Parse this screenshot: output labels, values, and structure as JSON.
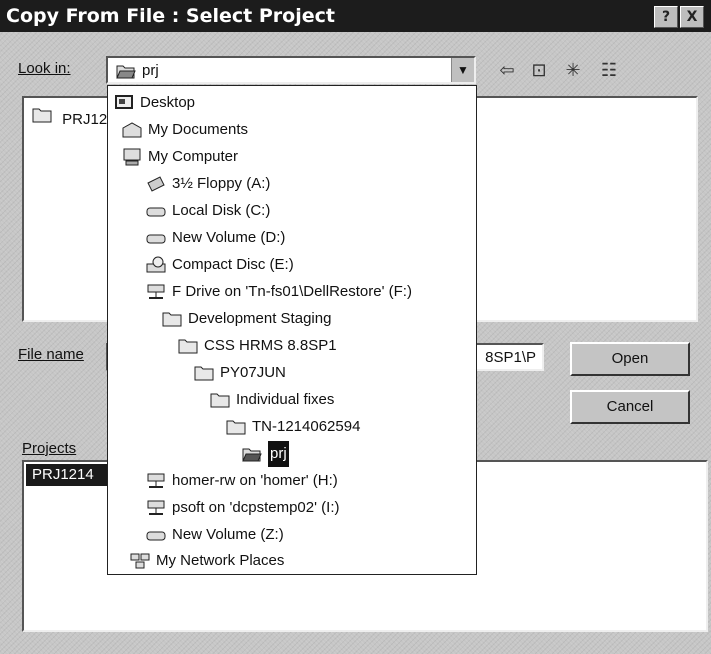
{
  "window": {
    "title": "Copy From File : Select Project",
    "help_glyph": "?",
    "close_glyph": "X"
  },
  "lookin": {
    "label": "Look in:",
    "value": "prj"
  },
  "file_list": {
    "items": [
      "PRJ12"
    ]
  },
  "file_name": {
    "label": "File name",
    "value": "8SP1\\P"
  },
  "projects": {
    "label": "Projects",
    "selected": "PRJ1214"
  },
  "buttons": {
    "open": "Open",
    "cancel": "Cancel"
  },
  "dropdown": {
    "items": [
      {
        "label": "Desktop",
        "icon": "desktop-icon"
      },
      {
        "label": "My Documents",
        "icon": "folder-docs-icon"
      },
      {
        "label": "My Computer",
        "icon": "computer-icon"
      },
      {
        "label": "3½ Floppy (A:)",
        "icon": "floppy-icon"
      },
      {
        "label": "Local Disk (C:)",
        "icon": "disk-icon"
      },
      {
        "label": "New Volume (D:)",
        "icon": "disk-icon"
      },
      {
        "label": "Compact Disc (E:)",
        "icon": "cd-icon"
      },
      {
        "label": "F Drive on 'Tn-fs01\\DellRestore' (F:)",
        "icon": "network-drive-icon"
      },
      {
        "label": "Development Staging",
        "icon": "folder-icon"
      },
      {
        "label": "CSS HRMS 8.8SP1",
        "icon": "folder-icon"
      },
      {
        "label": "PY07JUN",
        "icon": "folder-icon"
      },
      {
        "label": "Individual fixes",
        "icon": "folder-icon"
      },
      {
        "label": "TN-1214062594",
        "icon": "folder-icon"
      },
      {
        "label": "prj",
        "icon": "open-folder-icon"
      },
      {
        "label": "homer-rw on 'homer' (H:)",
        "icon": "network-drive-icon"
      },
      {
        "label": "psoft on 'dcpstemp02' (I:)",
        "icon": "network-drive-icon"
      },
      {
        "label": "New Volume (Z:)",
        "icon": "disk-icon"
      },
      {
        "label": "My Network Places",
        "icon": "network-places-icon"
      }
    ]
  }
}
